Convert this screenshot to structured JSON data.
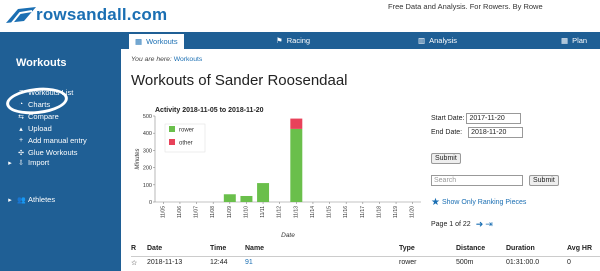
{
  "header": {
    "logo_text": "rowsandall.com",
    "tagline": "Free Data and Analysis. For Rowers. By Rowe"
  },
  "sidebar": {
    "title": "Workouts",
    "items": [
      {
        "label": "Workouts List",
        "icon": "list-icon"
      },
      {
        "label": "Charts",
        "icon": "pie-chart-icon"
      },
      {
        "label": "Compare",
        "icon": "compare-icon"
      },
      {
        "label": "Upload",
        "icon": "upload-icon"
      },
      {
        "label": "Add manual entry",
        "icon": "plus-icon"
      },
      {
        "label": "Glue Workouts",
        "icon": "glue-icon"
      },
      {
        "label": "Import",
        "icon": "caret-right-icon"
      },
      {
        "label": "Athletes",
        "icon": "users-icon"
      }
    ]
  },
  "tabs": [
    {
      "label": "Workouts",
      "icon": "calendar-icon",
      "active": true
    },
    {
      "label": "Racing",
      "icon": "flag-icon",
      "active": false
    },
    {
      "label": "Analysis",
      "icon": "bar-chart-icon",
      "active": false
    },
    {
      "label": "Plan",
      "icon": "calendar-icon",
      "active": false
    }
  ],
  "breadcrumb": {
    "prefix": "You are here:",
    "link": "Workouts"
  },
  "page_title": "Workouts of Sander Roosendaal",
  "chart_data": {
    "type": "bar",
    "stacked": true,
    "title": "Activity 2018-11-05 to 2018-11-20",
    "xlabel": "Date",
    "ylabel": "Minutes",
    "ylim": [
      0,
      500
    ],
    "yticks": [
      "0",
      "100",
      "200",
      "300",
      "400",
      "500"
    ],
    "categories": [
      "11/05",
      "11/06",
      "11/07",
      "11/08",
      "11/09",
      "11/10",
      "11/11",
      "11/12",
      "11/13",
      "11/14",
      "11/15",
      "11/16",
      "11/17",
      "11/18",
      "11/19",
      "11/20"
    ],
    "series": [
      {
        "name": "rower",
        "color": "#6abf4b",
        "values": [
          0,
          0,
          0,
          0,
          45,
          35,
          110,
          0,
          425,
          0,
          0,
          0,
          0,
          0,
          0,
          0
        ]
      },
      {
        "name": "other",
        "color": "#e8425a",
        "values": [
          0,
          0,
          0,
          0,
          0,
          0,
          0,
          0,
          60,
          0,
          0,
          0,
          0,
          0,
          0,
          0
        ]
      }
    ],
    "legend_position": "top-left",
    "grid": false
  },
  "form": {
    "start_label": "Start Date:",
    "start_value": "2017-11-20",
    "end_label": "End Date:",
    "end_value": "2018-11-20",
    "submit_label": "Submit",
    "search_placeholder": "Search",
    "search_submit_label": "Submit",
    "ranking_link": "Show Only Ranking Pieces",
    "page_info": "Page 1 of 22"
  },
  "table": {
    "headers": [
      "R",
      "Date",
      "Time",
      "Name",
      "Type",
      "Distance",
      "Duration",
      "Avg HR"
    ],
    "rows": [
      [
        "☆",
        "2018-11-13",
        "12:44",
        "91",
        "rower",
        "500m",
        "01:31:00.0",
        "0"
      ]
    ]
  }
}
